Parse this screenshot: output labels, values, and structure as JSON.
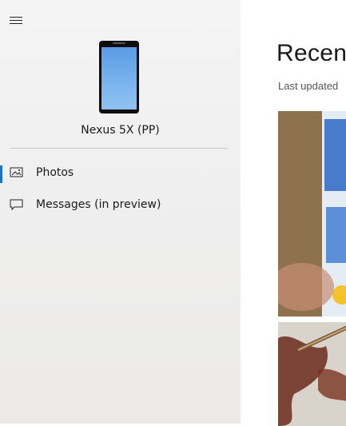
{
  "sidebar": {
    "device_name": "Nexus 5X (PP)",
    "nav": [
      {
        "label": "Photos",
        "icon": "photos-icon",
        "active": true
      },
      {
        "label": "Messages (in preview)",
        "icon": "message-icon",
        "active": false
      }
    ]
  },
  "main": {
    "title": "Recen",
    "subtitle": "Last updated"
  },
  "colors": {
    "accent": "#1a73c7",
    "sidebar_bg": "#efefef"
  }
}
